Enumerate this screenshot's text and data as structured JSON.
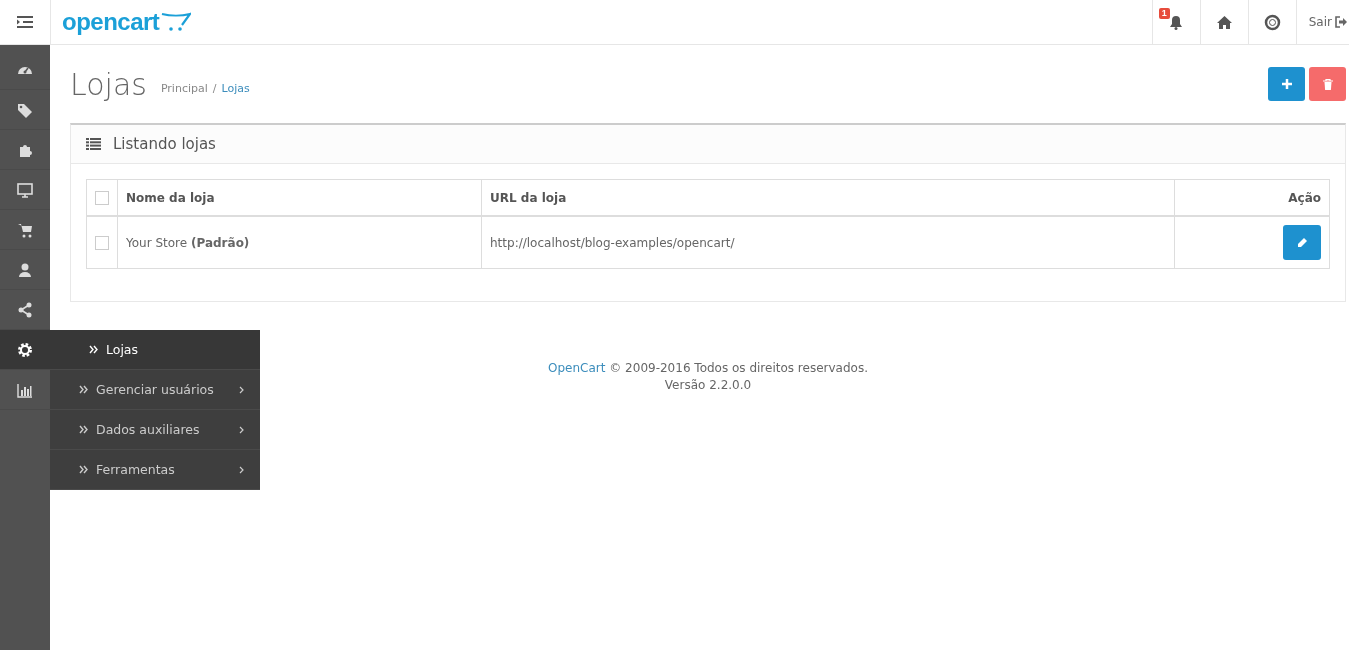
{
  "header": {
    "logo": "opencart",
    "notification_count": "1",
    "logout": "Sair"
  },
  "sidebar": {
    "items": [
      {
        "selected": false
      },
      {
        "selected": false
      },
      {
        "selected": false
      },
      {
        "selected": false
      },
      {
        "selected": false
      },
      {
        "selected": false
      },
      {
        "selected": false
      },
      {
        "selected": true
      },
      {
        "selected": false
      }
    ]
  },
  "submenu": {
    "items": [
      {
        "label": "Lojas",
        "selected": true,
        "expandable": false
      },
      {
        "label": "Gerenciar usuários",
        "selected": false,
        "expandable": true
      },
      {
        "label": "Dados auxiliares",
        "selected": false,
        "expandable": true
      },
      {
        "label": "Ferramentas",
        "selected": false,
        "expandable": true
      }
    ]
  },
  "page": {
    "title": "Lojas",
    "breadcrumb": [
      "Principal",
      "Lojas"
    ],
    "breadcrumb_separator": "/"
  },
  "panel": {
    "title": "Listando lojas"
  },
  "table": {
    "select_all": {
      "checked": false
    },
    "columns": [
      "Nome da loja",
      "URL da loja",
      "Ação"
    ],
    "rows": [
      {
        "checked": false,
        "name": "Your Store **(Padrão)**",
        "url": "http://localhost/blog-examples/opencart/"
      }
    ]
  },
  "footer": {
    "link": "OpenCart",
    "copyright": "© 2009-2016 Todos os direitos reservados.",
    "version": "Versão 2.2.0.0"
  }
}
